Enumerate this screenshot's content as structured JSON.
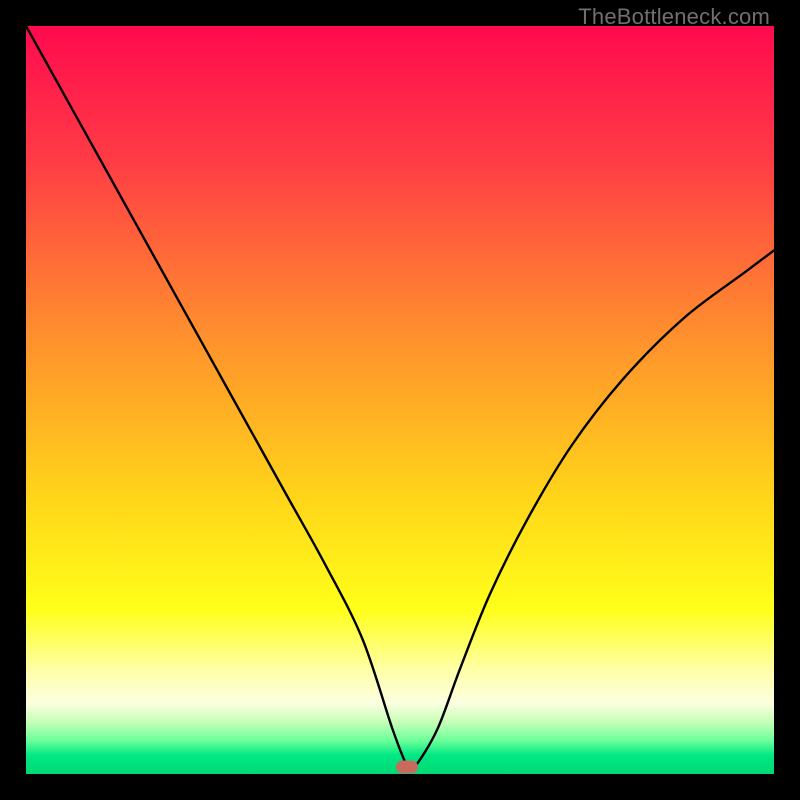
{
  "watermark": {
    "text": "TheBottleneck.com"
  },
  "chart_data": {
    "type": "line",
    "title": "",
    "xlabel": "",
    "ylabel": "",
    "xlim": [
      0,
      100
    ],
    "ylim": [
      0,
      100
    ],
    "gradient_stops": [
      {
        "pos": 0,
        "color": "#ff0a4e"
      },
      {
        "pos": 0.18,
        "color": "#ff3c45"
      },
      {
        "pos": 0.4,
        "color": "#ff8b2f"
      },
      {
        "pos": 0.62,
        "color": "#ffd21a"
      },
      {
        "pos": 0.78,
        "color": "#ffff1a"
      },
      {
        "pos": 0.86,
        "color": "#ffffa6"
      },
      {
        "pos": 0.905,
        "color": "#fbffe0"
      },
      {
        "pos": 0.93,
        "color": "#c8ffb8"
      },
      {
        "pos": 0.955,
        "color": "#6dff9a"
      },
      {
        "pos": 0.975,
        "color": "#00e884"
      },
      {
        "pos": 1.0,
        "color": "#00d874"
      }
    ],
    "series": [
      {
        "name": "bottleneck-curve",
        "x": [
          0,
          5,
          10,
          15,
          20,
          25,
          30,
          35,
          40,
          45,
          49,
          51,
          52,
          55,
          58,
          62,
          67,
          73,
          80,
          88,
          96,
          100
        ],
        "y": [
          100,
          91,
          82,
          73,
          64,
          55,
          46,
          37,
          28,
          18,
          6,
          1,
          1,
          6,
          14,
          24,
          34,
          44,
          53,
          61,
          67,
          70
        ]
      }
    ],
    "marker": {
      "x": 51,
      "y": 1,
      "color": "#c96a5f"
    }
  }
}
